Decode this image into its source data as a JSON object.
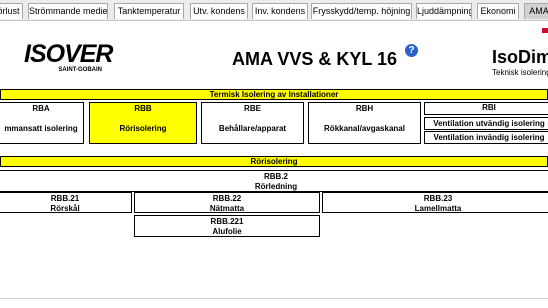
{
  "tabs": [
    {
      "label": "örlust",
      "active": false
    },
    {
      "label": "Strömmande medie",
      "active": false
    },
    {
      "label": "Tanktemperatur",
      "active": false
    },
    {
      "label": "Utv. kondens",
      "active": false
    },
    {
      "label": "Inv. kondens",
      "active": false
    },
    {
      "label": "Frysskydd/temp. höjning",
      "active": false
    },
    {
      "label": "Ljuddämpning",
      "active": false
    },
    {
      "label": "Ekonomi",
      "active": false
    },
    {
      "label": "AMA",
      "active": true
    }
  ],
  "header": {
    "logo_word": "ISOVER",
    "logo_sub": "SAINT-GOBAIN",
    "title": "AMA VVS & KYL 16",
    "help_symbol": "?",
    "brand": "IsoDim",
    "brand_sub": "Teknisk isolering"
  },
  "installations": {
    "heading": "Termisk Isolering av Installationer",
    "items": [
      {
        "code": "RBA",
        "label": "mmansatt isolering",
        "selected": false
      },
      {
        "code": "RBB",
        "label": "Rörisolering",
        "selected": true
      },
      {
        "code": "RBE",
        "label": "Behållare/apparat",
        "selected": false
      },
      {
        "code": "RBH",
        "label": "Rökkanal/avgaskanal",
        "selected": false
      },
      {
        "code": "RBI",
        "label": "",
        "selected": false
      }
    ],
    "rbi_subitems": [
      {
        "label": "Ventilation utvändig isolering"
      },
      {
        "label": "Ventilation invändig isolering"
      }
    ]
  },
  "pipe": {
    "heading": "Rörisolering",
    "parent": {
      "code": "RBB.2",
      "label": "Rörledning"
    },
    "children": [
      {
        "code": "RBB.21",
        "label": "Rörskål"
      },
      {
        "code": "RBB.22",
        "label": "Nätmatta"
      },
      {
        "code": "RBB.23",
        "label": "Lamellmatta"
      }
    ],
    "grandchild": {
      "code": "RBB.221",
      "label": "Alufolie"
    }
  },
  "colors": {
    "highlight": "#ffff00",
    "tab_active": "#d2d2d2",
    "help_icon": "#2a62c9",
    "flag": "#c8102e"
  },
  "icons": [
    "help-icon",
    "flag-icon"
  ]
}
